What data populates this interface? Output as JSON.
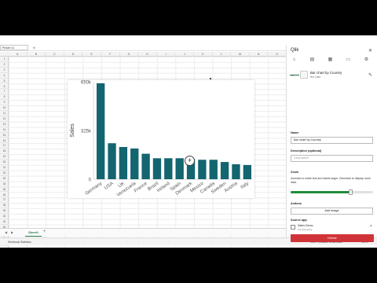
{
  "formula_bar": {
    "name_box": "Picture 11",
    "fx": "fx"
  },
  "grid": {
    "columns": [
      "A",
      "B",
      "C",
      "D",
      "E",
      "F",
      "G",
      "H",
      "I",
      "J",
      "K",
      "L",
      "M",
      "N",
      "O"
    ],
    "rows": [
      "1",
      "2",
      "3",
      "4",
      "5",
      "6",
      "7",
      "8",
      "9",
      "10",
      "11",
      "12",
      "13",
      "14",
      "15",
      "16",
      "17",
      "18",
      "19",
      "20",
      "21",
      "22",
      "23",
      "24",
      "25",
      "26",
      "27",
      "28",
      "29",
      "30",
      "31",
      "32",
      "33",
      "34",
      "35",
      "36",
      "37"
    ]
  },
  "sheet_tabs": {
    "active": "Sheet1",
    "add": "+"
  },
  "status_bar": {
    "left": "Workbook Statistics",
    "feedback": "Give Feedback to Microsoft",
    "zoom": "100%"
  },
  "panel": {
    "title": "Qlik",
    "close": "✕",
    "chart_name": "Bar chart by Country",
    "chart_type": "Bar chart",
    "name_label": "Name",
    "name_value": "Bar chart by Country",
    "desc_label": "Description (optional)",
    "desc_placeholder": "Description",
    "zoom_label": "Zoom",
    "zoom_help": "Increase to make text and labels larger. Decrease to display more data.",
    "zoom_fraction": 0.73,
    "actions_label": "Actions",
    "add_image": "Add image",
    "source_label": "Source app",
    "source_name": "Sales Demo",
    "source_sub": "For Reporting",
    "delete": "Delete"
  },
  "chart_data": {
    "type": "bar",
    "categories": [
      "Germany",
      "USA",
      "UK",
      "Venezuela",
      "France",
      "Brazil",
      "Ireland",
      "Spain",
      "Denmark",
      "Mexico",
      "Canada",
      "Sweden",
      "Austria",
      "Italy"
    ],
    "series": [
      {
        "values": [
          640,
          240,
          215,
          205,
          170,
          140,
          140,
          140,
          135,
          130,
          130,
          115,
          100,
          95
        ]
      }
    ],
    "mini_values": [
      640,
      240,
      215,
      205,
      170,
      140,
      140,
      140,
      135,
      130,
      130,
      115,
      100,
      95,
      80,
      60,
      45,
      35
    ],
    "title": "",
    "xlabel": "Country",
    "ylabel": "Sales",
    "yticks": [
      "0",
      "325k",
      "650k"
    ],
    "ylim": [
      0,
      650
    ],
    "color": "#136570",
    "grid": false
  }
}
